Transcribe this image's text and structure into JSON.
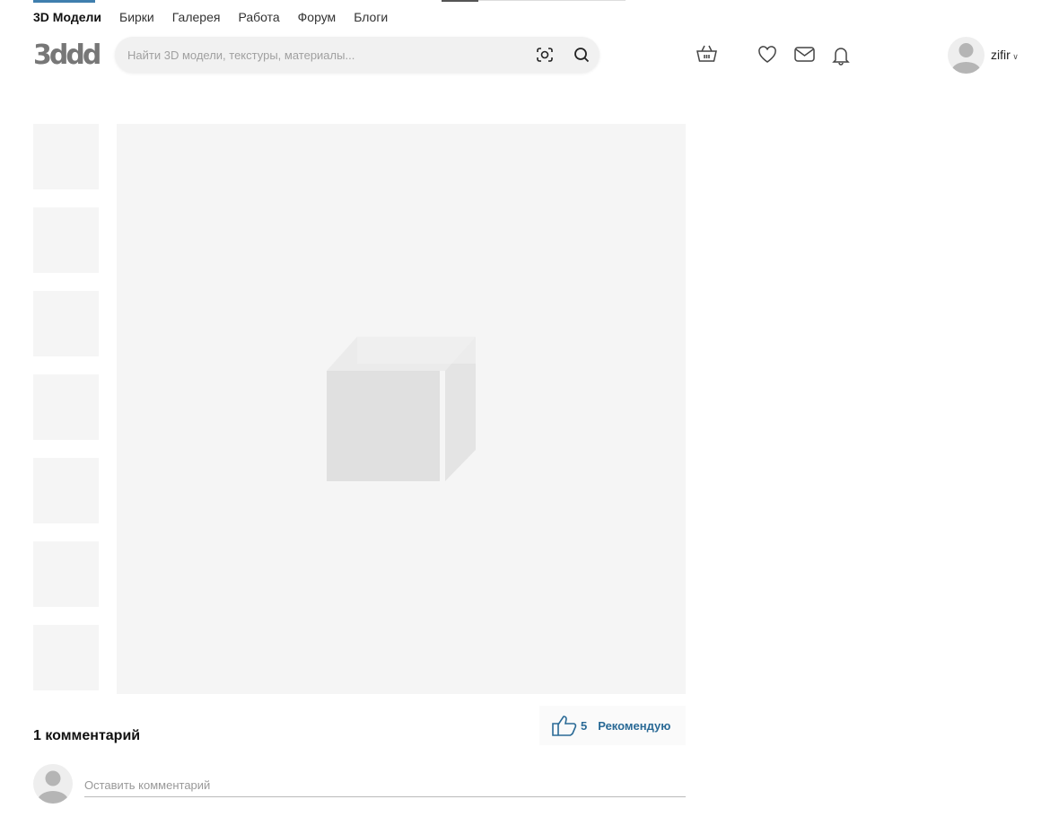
{
  "nav": {
    "items": [
      "3D Модели",
      "Бирки",
      "Галерея",
      "Работа",
      "Форум",
      "Блоги"
    ]
  },
  "logo": "3ddd",
  "search": {
    "placeholder": "Найти 3D модели, текстуры, материалы..."
  },
  "user": {
    "name": "zifir"
  },
  "comments": {
    "title": "1 комментарий",
    "placeholder": "Оставить комментарий"
  },
  "recommend": {
    "count": "5",
    "label": "Рекомендую"
  },
  "colors": {
    "accent": "#2a6a96"
  }
}
